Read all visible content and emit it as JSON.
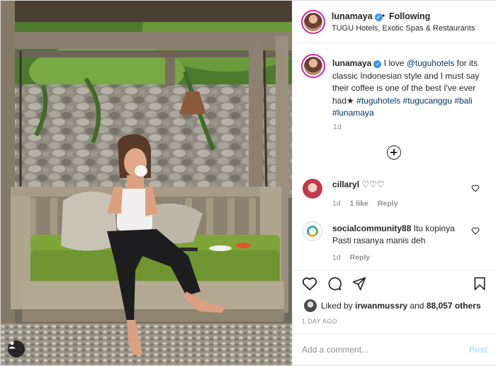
{
  "header": {
    "username": "lunamaya",
    "dot": "•",
    "follow_status": "Following",
    "location": "TUGU Hotels, Exotic Spas & Restaurants"
  },
  "caption": {
    "username": "lunamaya",
    "text_1": "I love",
    "mention": "@tuguhotels",
    "text_2": "for its classic Indonesian style and I must say their coffee is one of the best I've ever had",
    "emoji": "★",
    "tags": [
      "#tuguhotels",
      "#tugucanggu",
      "#bali",
      "#lunamaya"
    ],
    "time": "1d"
  },
  "comments": [
    {
      "username": "cillaryl",
      "text": "♡♡♡",
      "time": "1d",
      "likes": "1 like",
      "reply": "Reply"
    },
    {
      "username": "socialcommunity88",
      "text": "Itu kopinya Pasti rasanya manis deh",
      "time": "1d",
      "reply": "Reply"
    }
  ],
  "likes": {
    "prefix": "Liked by",
    "user": "irwanmussry",
    "and": "and",
    "others": "88,057 others"
  },
  "post_time": "1 DAY AGO",
  "comment_box": {
    "placeholder": "Add a comment...",
    "post_label": "Post"
  },
  "icons": {
    "verified": "verified-badge-icon",
    "load_more": "plus-circle-icon",
    "like": "heart-icon",
    "comment": "comment-bubble-icon",
    "share": "paper-plane-icon",
    "save": "bookmark-icon",
    "tag": "user-tag-icon"
  },
  "colors": {
    "verified": "#3897f0",
    "link": "#00376b",
    "muted": "#8e8e8e",
    "post_disabled": "#b2dffc",
    "story_ring": "#d6249f"
  }
}
